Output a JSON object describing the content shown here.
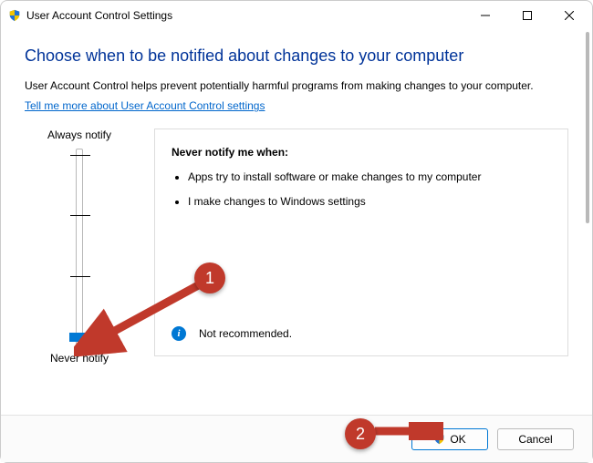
{
  "window": {
    "title": "User Account Control Settings"
  },
  "heading": "Choose when to be notified about changes to your computer",
  "intro": "User Account Control helps prevent potentially harmful programs from making changes to your computer.",
  "link_text": "Tell me more about User Account Control settings",
  "slider": {
    "top_label": "Always notify",
    "bottom_label": "Never notify"
  },
  "info": {
    "title": "Never notify me when:",
    "bullets": [
      "Apps try to install software or make changes to my computer",
      "I make changes to Windows settings"
    ],
    "status": "Not recommended."
  },
  "buttons": {
    "ok": "OK",
    "cancel": "Cancel"
  },
  "annotations": {
    "one": "1",
    "two": "2"
  }
}
